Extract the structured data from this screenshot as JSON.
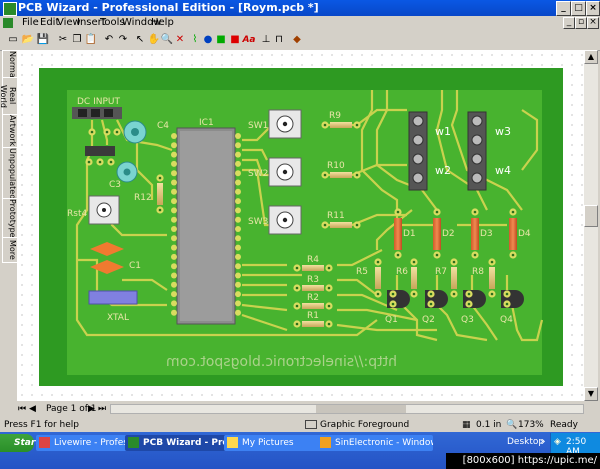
{
  "window": {
    "title": "PCB Wizard - Professional Edition - [Roym.pcb *]"
  },
  "menu": [
    "File",
    "Edit",
    "View",
    "Insert",
    "Tools",
    "Window",
    "Help"
  ],
  "side_tabs": [
    "Normal",
    "Real World",
    "Artwork",
    "Unpopulated",
    "Prototype",
    "More"
  ],
  "board": {
    "labels": {
      "dc_input": "DC INPUT",
      "ic1": "IC1",
      "c4": "C4",
      "c3": "C3",
      "c1": "C1",
      "r12": "R12",
      "rst4": "Rst4",
      "xtal": "XTAL",
      "sw1": "SW1",
      "sw2": "SW2",
      "sw3": "SW3",
      "r9": "R9",
      "r10": "R10",
      "r11": "R11",
      "r4": "R4",
      "r3": "R3",
      "r2": "R2",
      "r1": "R1",
      "w1": "w1",
      "w2": "w2",
      "w3": "w3",
      "w4": "w4",
      "d1": "D1",
      "d2": "D2",
      "d3": "D3",
      "d4": "D4",
      "r5": "R5",
      "r6": "R6",
      "r7": "R7",
      "r8": "R8",
      "q1": "Q1",
      "q2": "Q2",
      "q3": "Q3",
      "q4": "Q4"
    },
    "url_text": "http://sinelectronic.blogspot.com"
  },
  "status": {
    "page": "Page 1 of 1",
    "help": "Press F1 for help",
    "layer": "Graphic Foreground",
    "grid": "0.1 in",
    "zoom": "173%",
    "state": "Ready"
  },
  "taskbar": {
    "start": "Start",
    "tasks": [
      "Livewire - Professional E...",
      "PCB Wizard - Professi...",
      "My Pictures",
      "SinElectronic - Windows ..."
    ],
    "desktop": "Desktop",
    "clock": "2:50 AM",
    "overlay": "[800x600] https://upic.me/"
  },
  "colors": {
    "board": "#2d9a23",
    "board_inner": "#5bc838",
    "trace": "#c8d24a",
    "title_blue": "#0a58e4"
  }
}
